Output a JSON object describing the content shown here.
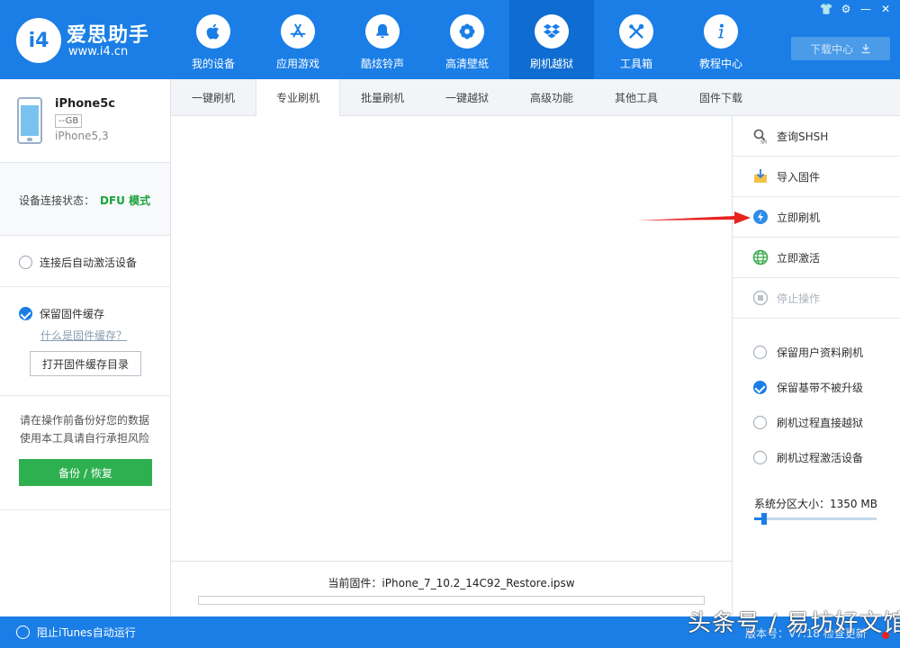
{
  "app": {
    "logo_mark": "i4",
    "logo_title": "爱思助手",
    "logo_url": "www.i4.cn"
  },
  "nav": [
    {
      "label": "我的设备",
      "icon": "apple-icon"
    },
    {
      "label": "应用游戏",
      "icon": "app-store-icon"
    },
    {
      "label": "酷炫铃声",
      "icon": "bell-icon"
    },
    {
      "label": "高清壁纸",
      "icon": "flower-icon"
    },
    {
      "label": "刷机越狱",
      "icon": "dropbox-icon"
    },
    {
      "label": "工具箱",
      "icon": "tools-icon"
    },
    {
      "label": "教程中心",
      "icon": "info-icon"
    }
  ],
  "window_controls": {
    "shirt": "👕",
    "settings": "⚙",
    "minimize": "—",
    "close": "✕"
  },
  "download_center": {
    "label": "下载中心",
    "icon": "download-icon"
  },
  "device": {
    "name": "iPhone5c",
    "capacity": "--GB",
    "model": "iPhone5,3"
  },
  "connection": {
    "label": "设备连接状态：",
    "value": "DFU 模式"
  },
  "left_options": {
    "auto_activate": "连接后自动激活设备",
    "keep_cache": "保留固件缓存",
    "what_is_cache": "什么是固件缓存？",
    "open_cache_dir": "打开固件缓存目录"
  },
  "warning": {
    "line1": "请在操作前备份好您的数据",
    "line2": "使用本工具请自行承担风险"
  },
  "backup_button": "备份 / 恢复",
  "tabs": [
    "一键刷机",
    "专业刷机",
    "批量刷机",
    "一键越狱",
    "高级功能",
    "其他工具",
    "固件下载"
  ],
  "active_tab": 1,
  "firmware": {
    "current": "当前固件：iPhone_7_10.2_14C92_Restore.ipsw",
    "progress": 0
  },
  "actions": [
    {
      "label": "查询SHSH",
      "icon": "search-shsh-icon",
      "enabled": true
    },
    {
      "label": "导入固件",
      "icon": "import-icon",
      "enabled": true
    },
    {
      "label": "立即刷机",
      "icon": "flash-icon",
      "enabled": true
    },
    {
      "label": "立即激活",
      "icon": "globe-icon",
      "enabled": true
    },
    {
      "label": "停止操作",
      "icon": "stop-icon",
      "enabled": false
    }
  ],
  "flash_options": [
    {
      "label": "保留用户资料刷机",
      "checked": false
    },
    {
      "label": "保留基带不被升级",
      "checked": true
    },
    {
      "label": "刷机过程直接越狱",
      "checked": false
    },
    {
      "label": "刷机过程激活设备",
      "checked": false
    }
  ],
  "system_partition": {
    "label": "系统分区大小：1350 MB",
    "fraction": 0.06
  },
  "footer": {
    "itunes": "阻止iTunes自动运行",
    "right_text": "版本号：V7.18   检查更新"
  },
  "watermark": "头条号 / 易坊好文馆",
  "colors": {
    "primary": "#1a7ee6",
    "green": "#2fb050",
    "dfu": "#1aa33c",
    "arrow": "#e8231e"
  }
}
